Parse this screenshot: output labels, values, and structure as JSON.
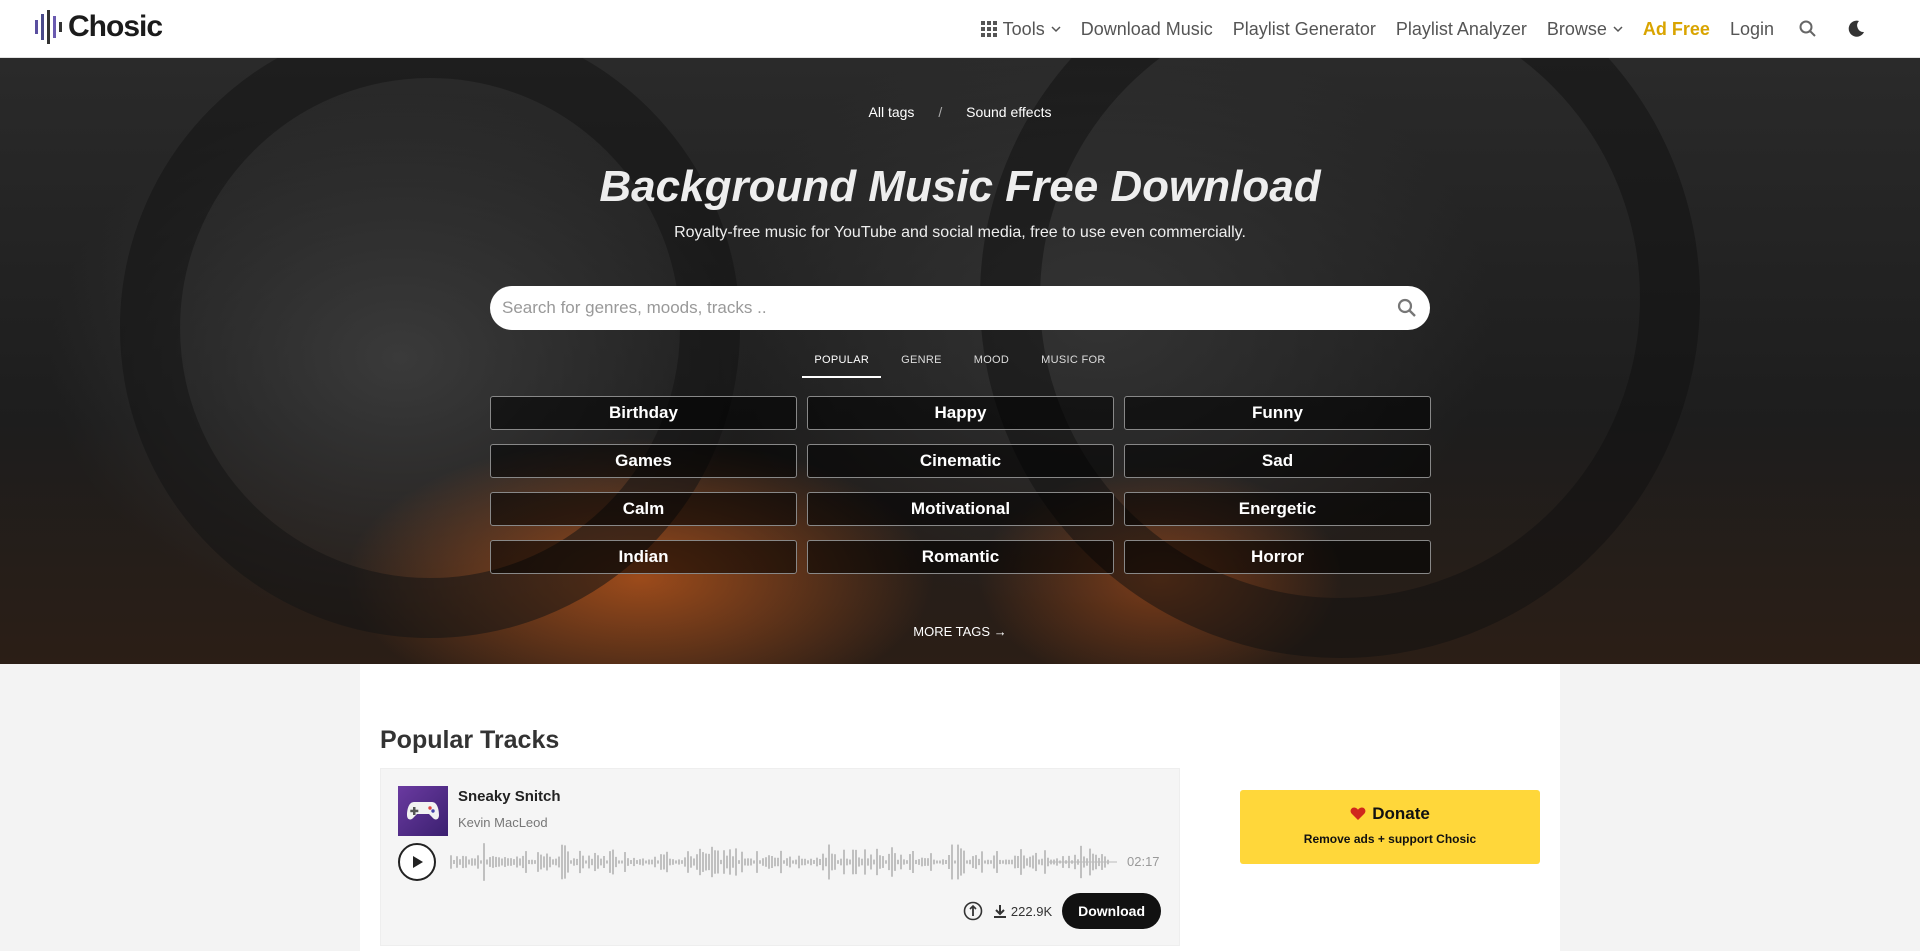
{
  "brand": {
    "name": "Chosic",
    "accent": "#d9a400"
  },
  "nav": {
    "tools": "Tools",
    "download_music": "Download Music",
    "playlist_generator": "Playlist Generator",
    "playlist_analyzer": "Playlist Analyzer",
    "browse": "Browse",
    "ad_free": "Ad Free",
    "login": "Login"
  },
  "hero": {
    "breadcrumb": {
      "all_tags": "All tags",
      "separator": "/",
      "sound_effects": "Sound effects"
    },
    "title": "Background Music Free Download",
    "subtitle": "Royalty-free music for YouTube and social media, free to use even commercially.",
    "search_placeholder": "Search for genres, moods, tracks ..",
    "tabs": [
      "POPULAR",
      "GENRE",
      "MOOD",
      "MUSIC FOR"
    ],
    "active_tab": "POPULAR",
    "tags": [
      "Birthday",
      "Happy",
      "Funny",
      "Games",
      "Cinematic",
      "Sad",
      "Calm",
      "Motivational",
      "Energetic",
      "Indian",
      "Romantic",
      "Horror"
    ],
    "more_tags": "MORE TAGS →"
  },
  "popular": {
    "title": "Popular Tracks",
    "track": {
      "name": "Sneaky Snitch",
      "artist": "Kevin MacLeod",
      "duration": "02:17",
      "downloads": "222.9K",
      "download_label": "Download"
    }
  },
  "donate": {
    "title": "Donate",
    "subtitle": "Remove ads + support Chosic",
    "color": "#ffd73a"
  }
}
